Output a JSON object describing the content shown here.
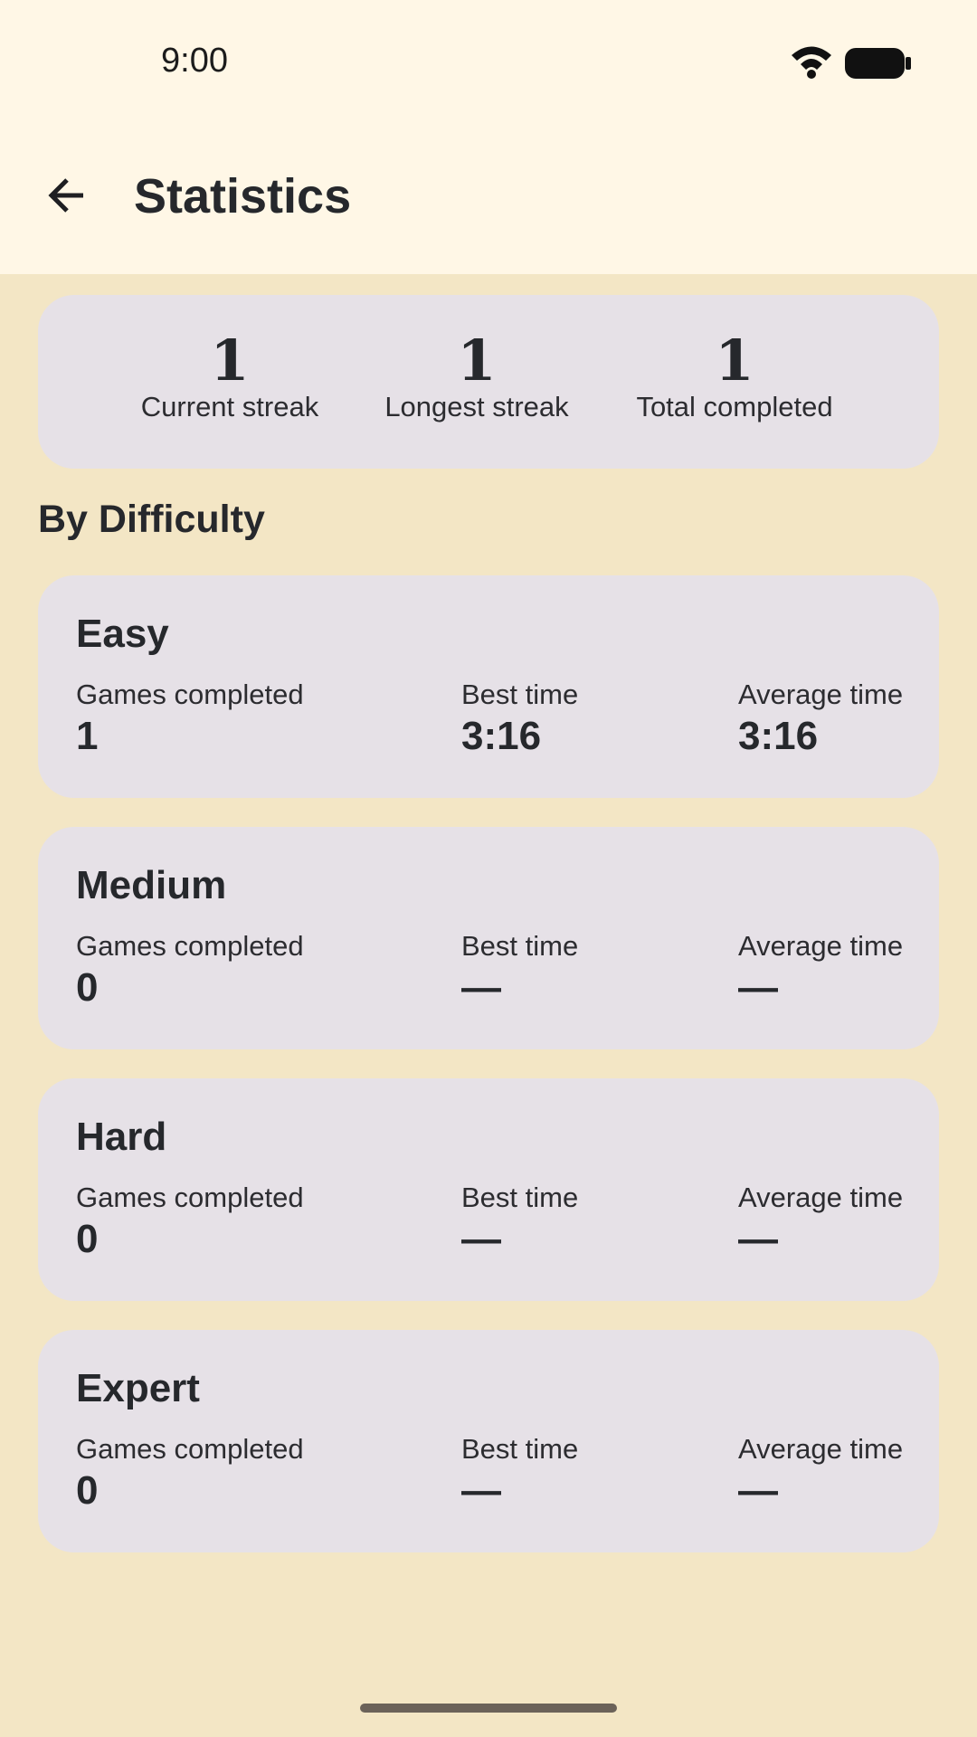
{
  "status_bar": {
    "time": "9:00",
    "wifi_icon": "wifi-icon",
    "battery_icon": "battery-icon"
  },
  "app_bar": {
    "back_icon": "arrow-back-icon",
    "title": "Statistics"
  },
  "summary": {
    "current_streak": {
      "value": "1",
      "label": "Current streak"
    },
    "longest_streak": {
      "value": "1",
      "label": "Longest streak"
    },
    "total_completed": {
      "value": "1",
      "label": "Total completed"
    }
  },
  "section_heading": "By Difficulty",
  "difficulties": [
    {
      "name": "Easy",
      "games_completed_label": "Games completed",
      "games_completed": "1",
      "best_time_label": "Best time",
      "best_time": "3:16",
      "average_time_label": "Average time",
      "average_time": "3:16"
    },
    {
      "name": "Medium",
      "games_completed_label": "Games completed",
      "games_completed": "0",
      "best_time_label": "Best time",
      "best_time": "—",
      "average_time_label": "Average time",
      "average_time": "—"
    },
    {
      "name": "Hard",
      "games_completed_label": "Games completed",
      "games_completed": "0",
      "best_time_label": "Best time",
      "best_time": "—",
      "average_time_label": "Average time",
      "average_time": "—"
    },
    {
      "name": "Expert",
      "games_completed_label": "Games completed",
      "games_completed": "0",
      "best_time_label": "Best time",
      "best_time": "—",
      "average_time_label": "Average time",
      "average_time": "—"
    }
  ],
  "colors": {
    "top_bar_background": "#fff7e6",
    "page_background": "#f3e6c5",
    "card_background": "#e6e1e7",
    "text": "#26282c"
  }
}
